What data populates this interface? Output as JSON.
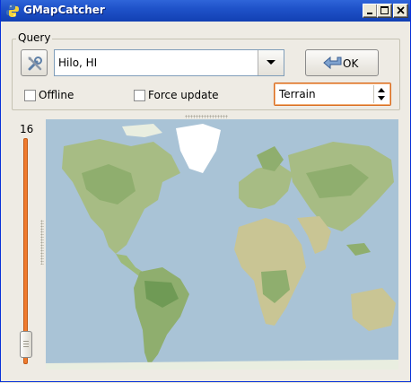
{
  "window": {
    "title": "GMapCatcher",
    "icon": "python-icon"
  },
  "query": {
    "legend": "Query",
    "location_value": "Hilo, HI",
    "ok_label": "OK",
    "offline_label": "Offline",
    "offline_checked": false,
    "force_update_label": "Force update",
    "force_update_checked": false,
    "map_type": "Terrain"
  },
  "zoom": {
    "level": "16",
    "slider_fraction": 0.9
  },
  "colors": {
    "titlebar": "#1f52c9",
    "slider": "#f07b2e",
    "ocean": "#a9c3d6",
    "land": "#a7bc84",
    "ice": "#ffffff"
  }
}
